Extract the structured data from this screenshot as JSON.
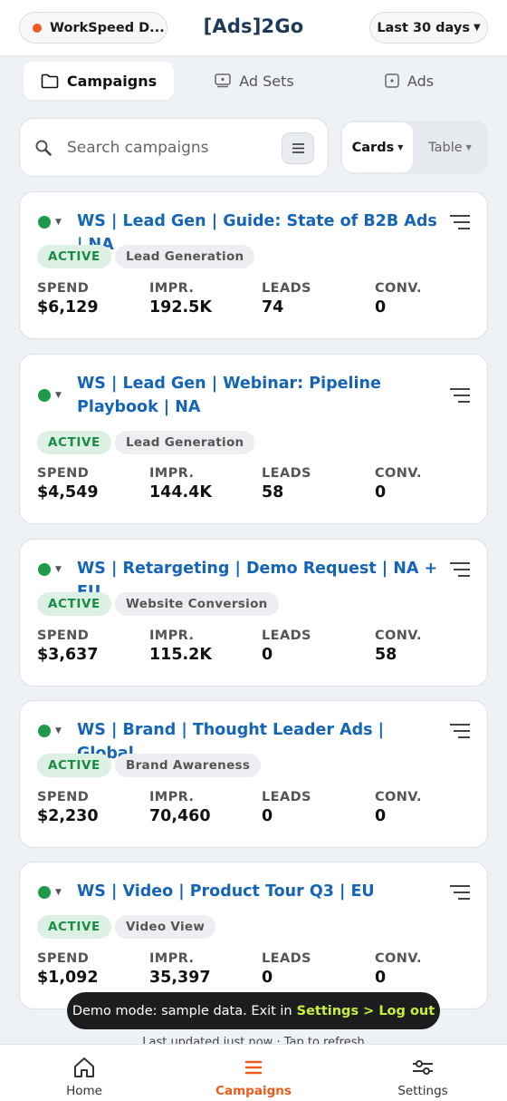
{
  "header": {
    "account_name": "WorkSpeed D...",
    "app_title": "[Ads]2Go",
    "date_range": "Last 30 days"
  },
  "tabs": [
    {
      "label": "Campaigns",
      "icon": "folder-icon",
      "active": true
    },
    {
      "label": "Ad Sets",
      "icon": "adset-icon",
      "active": false
    },
    {
      "label": "Ads",
      "icon": "ad-icon",
      "active": false
    }
  ],
  "search": {
    "placeholder": "Search campaigns",
    "value": ""
  },
  "view_toggle": {
    "cards_label": "Cards",
    "table_label": "Table",
    "active": "Cards"
  },
  "metric_labels": {
    "spend": "SPEND",
    "impressions": "IMPR.",
    "leads": "LEADS",
    "conversions": "CONV."
  },
  "campaigns": [
    {
      "title": "WS | Lead Gen | Guide: State of B2B Ads | NA",
      "status": "ACTIVE",
      "objective": "Lead Generation",
      "spend": "$6,129",
      "impressions": "192.5K",
      "leads": "74",
      "conversions": "0"
    },
    {
      "title": "WS | Lead Gen | Webinar: Pipeline Playbook | NA",
      "status": "ACTIVE",
      "objective": "Lead Generation",
      "spend": "$4,549",
      "impressions": "144.4K",
      "leads": "58",
      "conversions": "0"
    },
    {
      "title": "WS | Retargeting | Demo Request | NA + EU",
      "status": "ACTIVE",
      "objective": "Website Conversion",
      "spend": "$3,637",
      "impressions": "115.2K",
      "leads": "0",
      "conversions": "58"
    },
    {
      "title": "WS | Brand | Thought Leader Ads | Global",
      "status": "ACTIVE",
      "objective": "Brand Awareness",
      "spend": "$2,230",
      "impressions": "70,460",
      "leads": "0",
      "conversions": "0"
    },
    {
      "title": "WS | Video | Product Tour Q3 | EU",
      "status": "ACTIVE",
      "objective": "Video View",
      "spend": "$1,092",
      "impressions": "35,397",
      "leads": "0",
      "conversions": "0"
    }
  ],
  "toast": {
    "message": "Demo mode: sample data. Exit in",
    "link": "Settings > Log out"
  },
  "footer": {
    "refresh_text": "Last updated just now · Tap to refresh"
  },
  "bottom_nav": [
    {
      "label": "Home",
      "icon": "home-icon",
      "active": false
    },
    {
      "label": "Campaigns",
      "icon": "list-icon",
      "active": true
    },
    {
      "label": "Settings",
      "icon": "sliders-icon",
      "active": false
    }
  ],
  "colors": {
    "accent": "#ef5a1c",
    "link": "#1565b7",
    "status_active": "#1f9a4b",
    "toast_link": "#c8ef3a"
  }
}
